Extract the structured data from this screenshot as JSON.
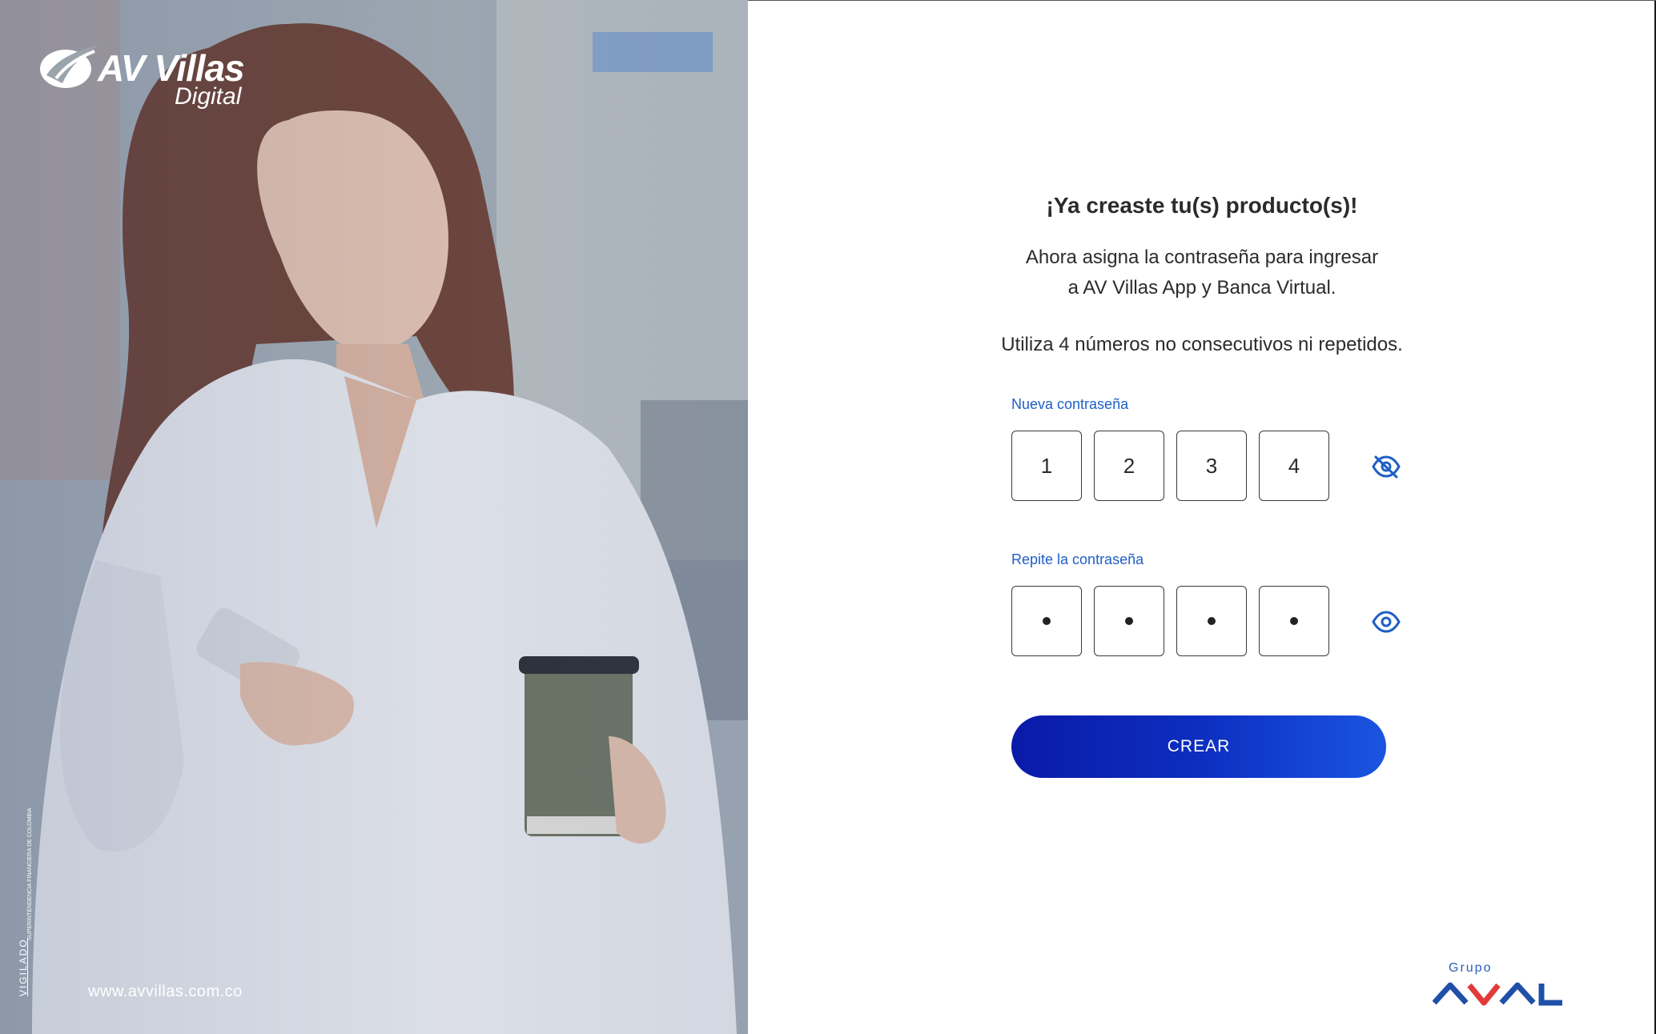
{
  "hero": {
    "brand_name": "AV Villas",
    "brand_sub": "Digital",
    "logo_icon": "av-villas-swoosh-icon",
    "vigilado": "VIGILADO",
    "vigilado_sub": "SUPERINTENDENCIA FINANCIERA DE COLOMBIA",
    "website": "www.avvillas.com.co"
  },
  "form": {
    "title": "¡Ya creaste tu(s) producto(s)!",
    "subtitle_line1": "Ahora asigna la contraseña para ingresar",
    "subtitle_line2": "a AV Villas App  y Banca Virtual.",
    "hint": "Utiliza 4 números no consecutivos ni repetidos.",
    "new_password": {
      "label": "Nueva contraseña",
      "digits": [
        "1",
        "2",
        "3",
        "4"
      ],
      "visible": true,
      "toggle_icon": "eye-slash-icon"
    },
    "repeat_password": {
      "label": "Repite la contraseña",
      "digits": [
        "•",
        "•",
        "•",
        "•"
      ],
      "visible": false,
      "toggle_icon": "eye-icon"
    },
    "submit_label": "CREAR"
  },
  "footer": {
    "group_label": "Grupo",
    "group_logo": "aval-logo"
  },
  "colors": {
    "accent_blue": "#1f5fc6",
    "button_start": "#0a1aa8",
    "button_end": "#1a55e0",
    "aval_red": "#e23b3b",
    "aval_blue": "#1f4fa8"
  }
}
